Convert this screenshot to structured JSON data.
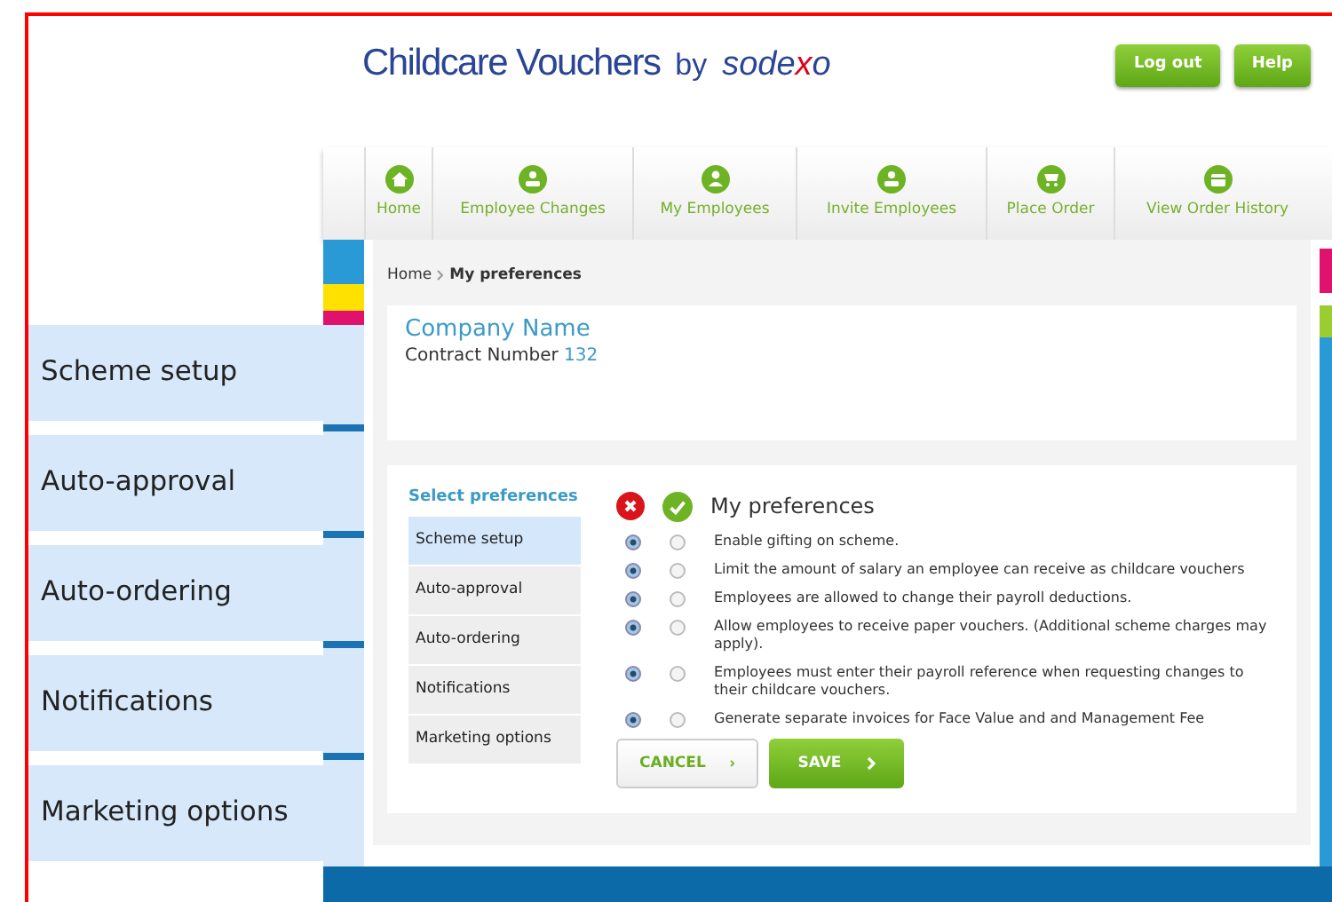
{
  "header": {
    "logo": {
      "title": "Childcare Vouchers",
      "by": "by",
      "brand_parts": [
        {
          "text": "sode",
          "accent": false
        },
        {
          "text": "x",
          "accent": true
        },
        {
          "text": "o",
          "accent": false
        }
      ]
    },
    "buttons": [
      "Log out",
      "Help"
    ]
  },
  "nav": [
    {
      "label": "Home",
      "kind": "home"
    },
    {
      "label": "Employee Changes",
      "kind": "people"
    },
    {
      "label": "My Employees",
      "kind": "person"
    },
    {
      "label": "Invite Employees",
      "kind": "people"
    },
    {
      "label": "Place Order",
      "kind": "cart"
    },
    {
      "label": "View Order History",
      "kind": "calendar"
    }
  ],
  "breadcrumb": [
    "Home",
    "My preferences"
  ],
  "company": {
    "name": "Company Name",
    "contract_label": "Contract Number",
    "contract_number": "132"
  },
  "preferences": {
    "menu_title": "Select preferences",
    "menu": [
      {
        "label": "Scheme setup",
        "selected": true
      },
      {
        "label": "Auto-approval",
        "selected": false
      },
      {
        "label": "Auto-ordering",
        "selected": false
      },
      {
        "label": "Notifications",
        "selected": false
      },
      {
        "label": "Marketing options",
        "selected": false
      }
    ],
    "title": "My preferences",
    "rows": [
      {
        "text": "Enable gifting on scheme.",
        "radios": [
          {
            "selected": true
          },
          {
            "selected": false
          }
        ]
      },
      {
        "text": "Limit the amount of salary an employee can receive as childcare vouchers",
        "radios": [
          {
            "selected": true
          },
          {
            "selected": false
          }
        ]
      },
      {
        "text": "Employees are allowed to change their payroll deductions.",
        "radios": [
          {
            "selected": true
          },
          {
            "selected": false
          }
        ]
      },
      {
        "text": "Allow employees to receive paper vouchers. (Additional scheme charges may apply).",
        "radios": [
          {
            "selected": true
          },
          {
            "selected": false
          }
        ]
      },
      {
        "text": "Employees must enter their payroll reference when requesting changes to their childcare vouchers.",
        "radios": [
          {
            "selected": true
          },
          {
            "selected": false
          }
        ]
      },
      {
        "text": "Generate separate invoices for Face Value and and Management Fee",
        "radios": [
          {
            "selected": true
          },
          {
            "selected": false
          }
        ]
      }
    ],
    "buttons": [
      {
        "label": "CANCEL",
        "kind": "secondary"
      },
      {
        "label": "SAVE",
        "kind": "primary"
      }
    ]
  },
  "callouts": [
    "Scheme setup",
    "Auto-approval",
    "Auto-ordering",
    "Notifications",
    "Marketing options"
  ]
}
